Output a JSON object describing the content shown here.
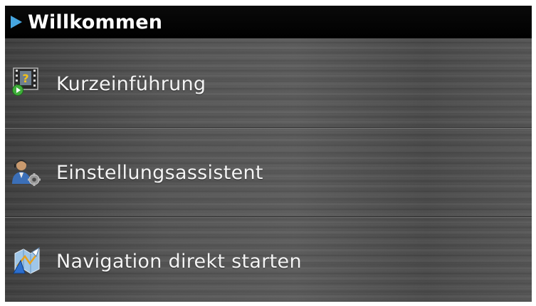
{
  "header": {
    "title": "Willkommen",
    "arrow_icon": "play-arrow-icon",
    "accent_color": "#46a6e0"
  },
  "menu": {
    "items": [
      {
        "label": "Kurzeinführung",
        "icon": "film-help-icon"
      },
      {
        "label": "Einstellungsassistent",
        "icon": "user-settings-icon"
      },
      {
        "label": "Navigation direkt starten",
        "icon": "map-navigation-icon"
      }
    ]
  }
}
